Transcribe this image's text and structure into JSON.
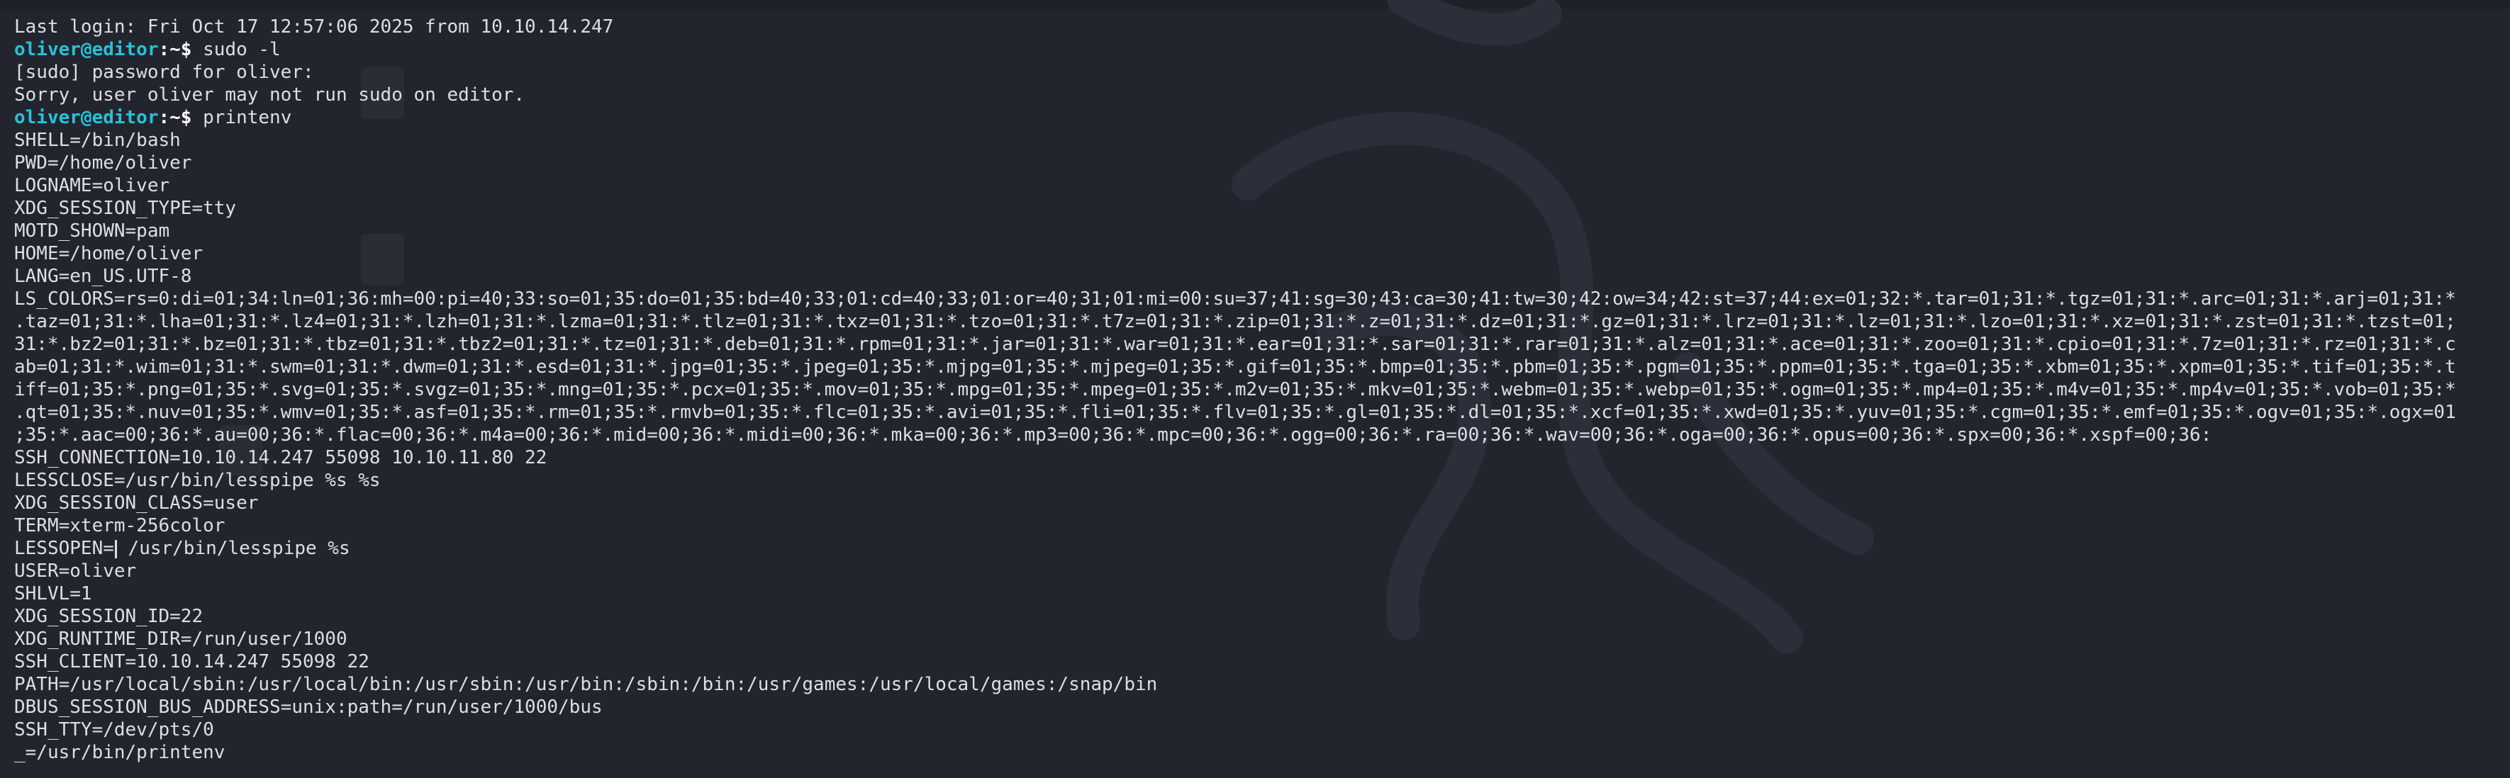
{
  "terminal": {
    "last_login": "Last login: Fri Oct 17 12:57:06 2025 from 10.10.14.247",
    "prompt_user": "oliver@editor",
    "prompt_path": ":~$",
    "cmd1": " sudo -l",
    "sudo_password": "[sudo] password for oliver:",
    "sudo_denied": "Sorry, user oliver may not run sudo on editor.",
    "cmd2": " printenv",
    "env": [
      "SHELL=/bin/bash",
      "PWD=/home/oliver",
      "LOGNAME=oliver",
      "XDG_SESSION_TYPE=tty",
      "MOTD_SHOWN=pam",
      "HOME=/home/oliver",
      "LANG=en_US.UTF-8",
      "LS_COLORS=rs=0:di=01;34:ln=01;36:mh=00:pi=40;33:so=01;35:do=01;35:bd=40;33;01:cd=40;33;01:or=40;31;01:mi=00:su=37;41:sg=30;43:ca=30;41:tw=30;42:ow=34;42:st=37;44:ex=01;32:*.tar=01;31:*.tgz=01;31:*.arc=01;31:*.arj=01;31:*",
      ".taz=01;31:*.lha=01;31:*.lz4=01;31:*.lzh=01;31:*.lzma=01;31:*.tlz=01;31:*.txz=01;31:*.tzo=01;31:*.t7z=01;31:*.zip=01;31:*.z=01;31:*.dz=01;31:*.gz=01;31:*.lrz=01;31:*.lz=01;31:*.lzo=01;31:*.xz=01;31:*.zst=01;31:*.tzst=01;",
      "31:*.bz2=01;31:*.bz=01;31:*.tbz=01;31:*.tbz2=01;31:*.tz=01;31:*.deb=01;31:*.rpm=01;31:*.jar=01;31:*.war=01;31:*.ear=01;31:*.sar=01;31:*.rar=01;31:*.alz=01;31:*.ace=01;31:*.zoo=01;31:*.cpio=01;31:*.7z=01;31:*.rz=01;31:*.c",
      "ab=01;31:*.wim=01;31:*.swm=01;31:*.dwm=01;31:*.esd=01;31:*.jpg=01;35:*.jpeg=01;35:*.mjpg=01;35:*.mjpeg=01;35:*.gif=01;35:*.bmp=01;35:*.pbm=01;35:*.pgm=01;35:*.ppm=01;35:*.tga=01;35:*.xbm=01;35:*.xpm=01;35:*.tif=01;35:*.t",
      "iff=01;35:*.png=01;35:*.svg=01;35:*.svgz=01;35:*.mng=01;35:*.pcx=01;35:*.mov=01;35:*.mpg=01;35:*.mpeg=01;35:*.m2v=01;35:*.mkv=01;35:*.webm=01;35:*.webp=01;35:*.ogm=01;35:*.mp4=01;35:*.m4v=01;35:*.mp4v=01;35:*.vob=01;35:*",
      ".qt=01;35:*.nuv=01;35:*.wmv=01;35:*.asf=01;35:*.rm=01;35:*.rmvb=01;35:*.flc=01;35:*.avi=01;35:*.fli=01;35:*.flv=01;35:*.gl=01;35:*.dl=01;35:*.xcf=01;35:*.xwd=01;35:*.yuv=01;35:*.cgm=01;35:*.emf=01;35:*.ogv=01;35:*.ogx=01",
      ";35:*.aac=00;36:*.au=00;36:*.flac=00;36:*.m4a=00;36:*.mid=00;36:*.midi=00;36:*.mka=00;36:*.mp3=00;36:*.mpc=00;36:*.ogg=00;36:*.ra=00;36:*.wav=00;36:*.oga=00;36:*.opus=00;36:*.spx=00;36:*.xspf=00;36:",
      "SSH_CONNECTION=10.10.14.247 55098 10.10.11.80 22",
      "LESSCLOSE=/usr/bin/lesspipe %s %s",
      "XDG_SESSION_CLASS=user",
      "TERM=xterm-256color"
    ],
    "lessopen_a": "LESSOPEN=",
    "lessopen_b": " /usr/bin/lesspipe %s",
    "env2": [
      "USER=oliver",
      "SHLVL=1",
      "XDG_SESSION_ID=22",
      "XDG_RUNTIME_DIR=/run/user/1000",
      "SSH_CLIENT=10.10.14.247 55098 22",
      "PATH=/usr/local/sbin:/usr/local/bin:/usr/sbin:/usr/bin:/sbin:/bin:/usr/games:/usr/local/games:/snap/bin",
      "DBUS_SESSION_BUS_ADDRESS=unix:path=/run/user/1000/bus",
      "SSH_TTY=/dev/pts/0",
      "_=/usr/bin/printenv"
    ]
  },
  "colors": {
    "background": "#23252e",
    "prompt_user": "#27c2d9",
    "text": "#dcdfe4"
  }
}
